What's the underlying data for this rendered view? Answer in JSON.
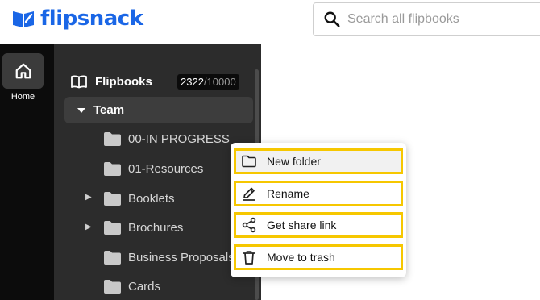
{
  "brand": {
    "name": "flipsnack",
    "color": "#1a66e6"
  },
  "search": {
    "placeholder": "Search all flipbooks",
    "icon": "search-icon"
  },
  "rail": {
    "items": [
      {
        "label": "Home",
        "icon": "home-icon"
      }
    ]
  },
  "sidebar": {
    "flipbooks": {
      "label": "Flipbooks",
      "icon": "open-book-icon",
      "count_used": "2322",
      "count_total": "/10000"
    },
    "team": {
      "label": "Team",
      "expanded": true
    },
    "folders": [
      {
        "label": "00-IN PROGRESS",
        "has_children": false
      },
      {
        "label": "01-Resources",
        "has_children": false
      },
      {
        "label": "Booklets",
        "has_children": true
      },
      {
        "label": "Brochures",
        "has_children": true
      },
      {
        "label": "Business Proposals",
        "has_children": false
      },
      {
        "label": "Cards",
        "has_children": false
      }
    ]
  },
  "context_menu": {
    "highlight_color": "#f6c700",
    "items": [
      {
        "label": "New folder",
        "icon": "folder-outline-icon"
      },
      {
        "label": "Rename",
        "icon": "pencil-icon"
      },
      {
        "label": "Get share link",
        "icon": "share-icon"
      },
      {
        "label": "Move to trash",
        "icon": "trash-icon"
      }
    ]
  }
}
